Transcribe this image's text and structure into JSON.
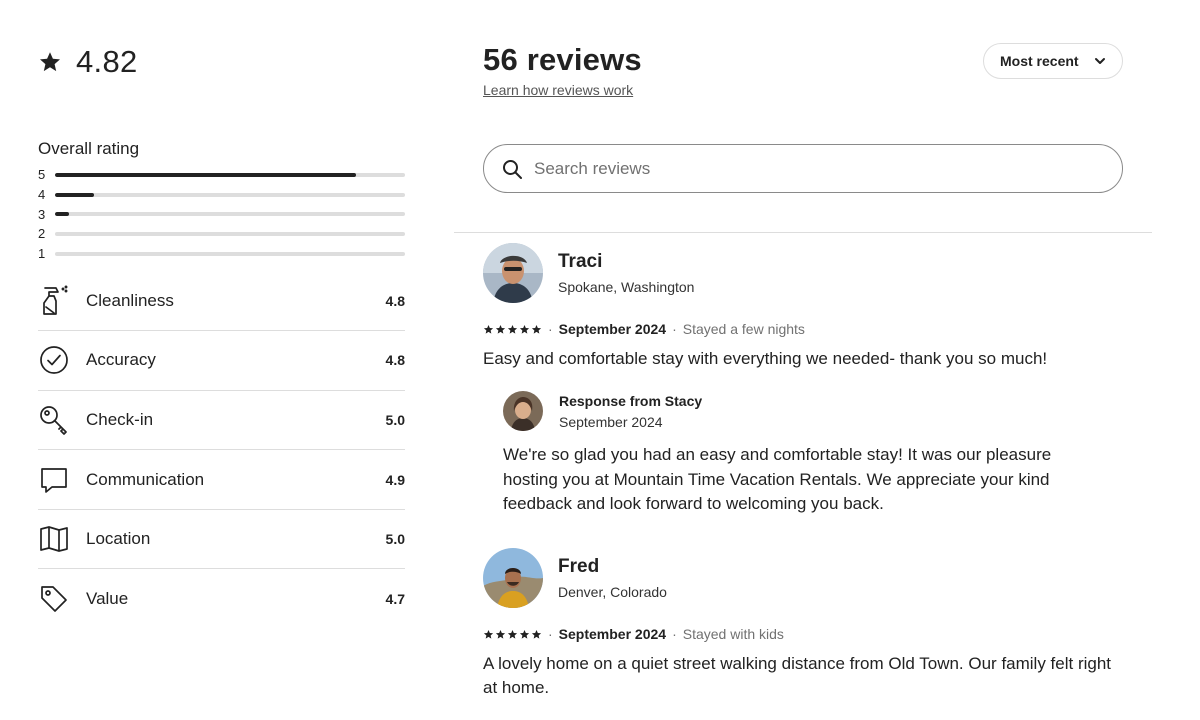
{
  "summary": {
    "average": "4.82",
    "overall_title": "Overall rating",
    "distribution": [
      {
        "stars": "5",
        "fraction": 0.86
      },
      {
        "stars": "4",
        "fraction": 0.11
      },
      {
        "stars": "3",
        "fraction": 0.04
      },
      {
        "stars": "2",
        "fraction": 0.0
      },
      {
        "stars": "1",
        "fraction": 0.0
      }
    ]
  },
  "categories": [
    {
      "label": "Cleanliness",
      "score": "4.8",
      "icon": "spray-bottle-icon"
    },
    {
      "label": "Accuracy",
      "score": "4.8",
      "icon": "check-circle-icon"
    },
    {
      "label": "Check-in",
      "score": "5.0",
      "icon": "key-icon"
    },
    {
      "label": "Communication",
      "score": "4.9",
      "icon": "chat-bubble-icon"
    },
    {
      "label": "Location",
      "score": "5.0",
      "icon": "map-icon"
    },
    {
      "label": "Value",
      "score": "4.7",
      "icon": "tag-icon"
    }
  ],
  "header": {
    "reviews_count": "56 reviews",
    "learn_link": "Learn how reviews work",
    "sort_label": "Most recent"
  },
  "search": {
    "placeholder": "Search reviews",
    "value": ""
  },
  "reviews": [
    {
      "name": "Traci",
      "location": "Spokane, Washington",
      "rating": 5,
      "date": "September 2024",
      "stay": "Stayed a few nights",
      "text": "Easy and comfortable stay with everything we needed- thank you so much!",
      "response": {
        "title": "Response from Stacy",
        "date": "September 2024",
        "text": "We're so glad you had an easy and comfortable stay! It was our pleasure hosting you at Mountain Time Vacation Rentals. We appreciate your kind feedback and look forward to welcoming you back."
      }
    },
    {
      "name": "Fred",
      "location": "Denver, Colorado",
      "rating": 5,
      "date": "September 2024",
      "stay": "Stayed with kids",
      "text": "A lovely home on a quiet street walking distance from Old Town. Our family felt right at home."
    }
  ],
  "colors": {
    "text": "#222222",
    "muted": "#717171",
    "divider": "#dddddd",
    "bar_fill": "#222222",
    "bar_track": "#dddddd"
  }
}
